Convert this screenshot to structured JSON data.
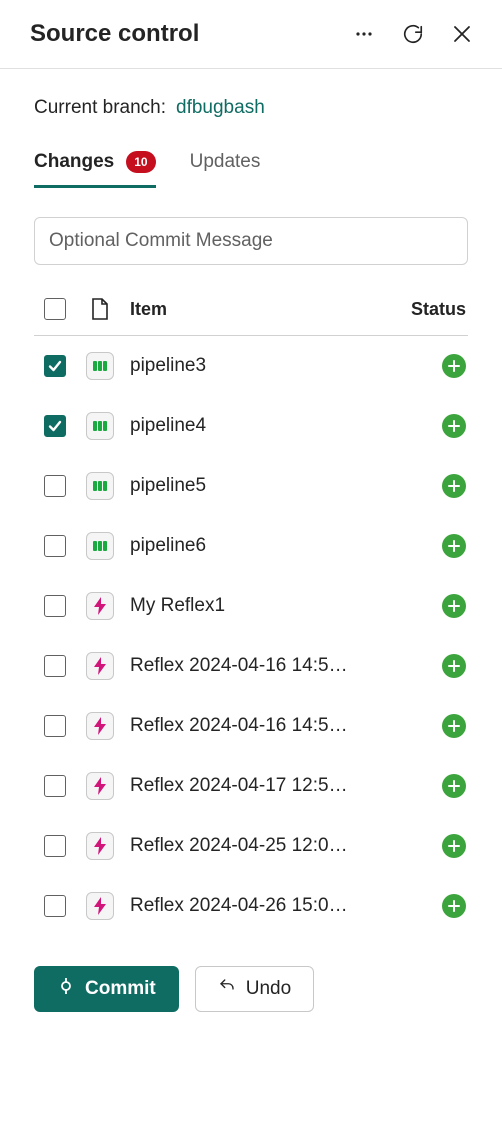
{
  "header": {
    "title": "Source control"
  },
  "branch": {
    "label": "Current branch:",
    "name": "dfbugbash"
  },
  "tabs": {
    "changes_label": "Changes",
    "changes_count": "10",
    "updates_label": "Updates"
  },
  "commit_placeholder": "Optional Commit Message",
  "columns": {
    "item": "Item",
    "status": "Status"
  },
  "items": [
    {
      "name": "pipeline3",
      "type": "pipeline",
      "checked": true,
      "status": "added"
    },
    {
      "name": "pipeline4",
      "type": "pipeline",
      "checked": true,
      "status": "added"
    },
    {
      "name": "pipeline5",
      "type": "pipeline",
      "checked": false,
      "status": "added"
    },
    {
      "name": "pipeline6",
      "type": "pipeline",
      "checked": false,
      "status": "added"
    },
    {
      "name": "My Reflex1",
      "type": "reflex",
      "checked": false,
      "status": "added"
    },
    {
      "name": "Reflex 2024-04-16 14:5…",
      "type": "reflex",
      "checked": false,
      "status": "added"
    },
    {
      "name": "Reflex 2024-04-16 14:5…",
      "type": "reflex",
      "checked": false,
      "status": "added"
    },
    {
      "name": "Reflex 2024-04-17 12:5…",
      "type": "reflex",
      "checked": false,
      "status": "added"
    },
    {
      "name": "Reflex 2024-04-25 12:0…",
      "type": "reflex",
      "checked": false,
      "status": "added"
    },
    {
      "name": "Reflex 2024-04-26 15:0…",
      "type": "reflex",
      "checked": false,
      "status": "added"
    }
  ],
  "buttons": {
    "commit": "Commit",
    "undo": "Undo"
  }
}
